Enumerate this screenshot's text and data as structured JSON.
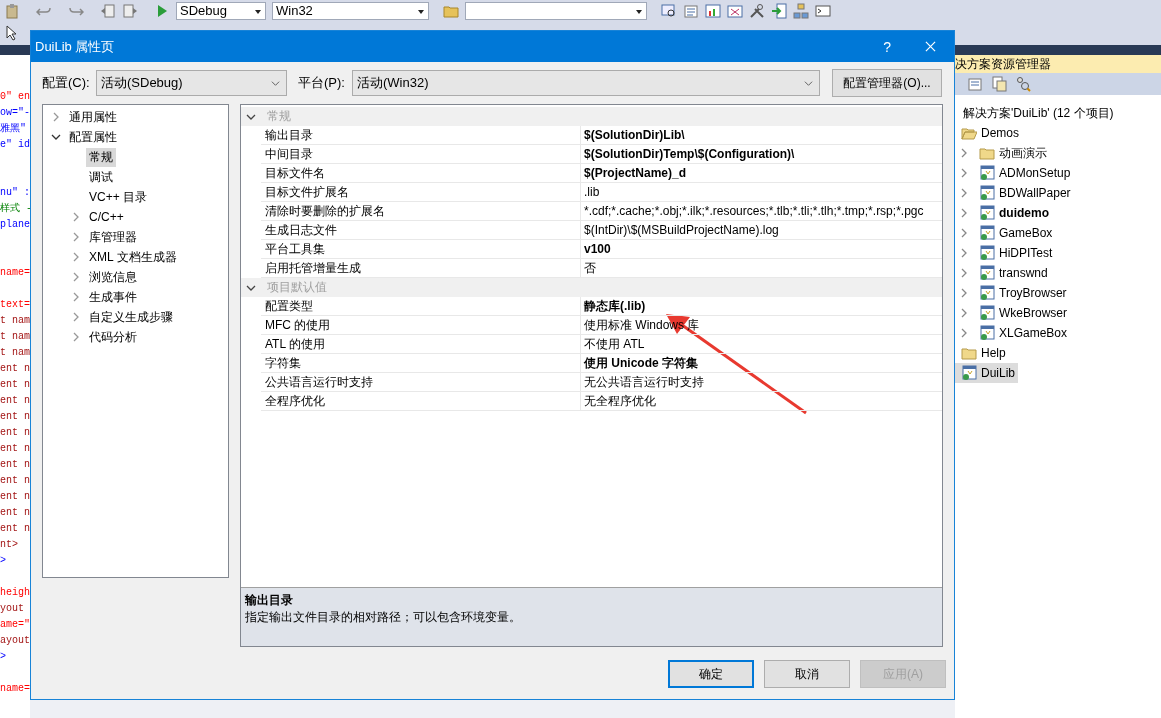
{
  "toolbar": {
    "configuration": "SDebug",
    "platform": "Win32"
  },
  "code_lines": [
    {
      "kind": "attribute",
      "text": "0\" en"
    },
    {
      "kind": "value",
      "text": "ow=\"-"
    },
    {
      "kind": "value",
      "text": "雅黑\""
    },
    {
      "kind": "value",
      "text": "e\" id"
    },
    {
      "kind": "blank"
    },
    {
      "kind": "blank"
    },
    {
      "kind": "value",
      "text": "nu\" :"
    },
    {
      "kind": "comment",
      "text": "样式 -"
    },
    {
      "kind": "value",
      "text": "plane"
    },
    {
      "kind": "blank"
    },
    {
      "kind": "blank"
    },
    {
      "kind": "attribute",
      "text": "name="
    },
    {
      "kind": "blank"
    },
    {
      "kind": "attribute",
      "text": "text="
    },
    {
      "kind": "tag",
      "text": "t nam"
    },
    {
      "kind": "tag",
      "text": "t nam"
    },
    {
      "kind": "tag",
      "text": "t nam"
    },
    {
      "kind": "tag",
      "text": "ent n"
    },
    {
      "kind": "tag",
      "text": "ent n"
    },
    {
      "kind": "tag",
      "text": "ent n"
    },
    {
      "kind": "tag",
      "text": "ent n"
    },
    {
      "kind": "tag",
      "text": "ent n"
    },
    {
      "kind": "tag",
      "text": "ent n"
    },
    {
      "kind": "tag",
      "text": "ent n"
    },
    {
      "kind": "tag",
      "text": "ent n"
    },
    {
      "kind": "tag",
      "text": "ent n"
    },
    {
      "kind": "tag",
      "text": "ent n"
    },
    {
      "kind": "tag",
      "text": "ent n"
    },
    {
      "kind": "tag",
      "text": "nt>"
    },
    {
      "kind": "value",
      "text": ">"
    },
    {
      "kind": "blank"
    },
    {
      "kind": "attribute",
      "text": "heigh"
    },
    {
      "kind": "tag",
      "text": "yout"
    },
    {
      "kind": "attribute",
      "text": "ame=\""
    },
    {
      "kind": "tag",
      "text": "ayout"
    },
    {
      "kind": "value",
      "text": ">"
    },
    {
      "kind": "blank"
    },
    {
      "kind": "attribute",
      "text": "name="
    }
  ],
  "solution_explorer": {
    "title": "决方案资源管理器",
    "root": "解决方案'DuiLib' (12 个项目)",
    "items": [
      {
        "label": "Demos",
        "kind": "folder",
        "expanded": true,
        "selected": false,
        "startup": false,
        "children": [
          {
            "label": "动画演示",
            "kind": "folder",
            "expanded": false,
            "selected": false,
            "startup": false
          },
          {
            "label": "ADMonSetup",
            "kind": "project",
            "expanded": false,
            "selected": false,
            "startup": false
          },
          {
            "label": "BDWallPaper",
            "kind": "project",
            "expanded": false,
            "selected": false,
            "startup": false
          },
          {
            "label": "duidemo",
            "kind": "project",
            "expanded": false,
            "selected": false,
            "startup": true
          },
          {
            "label": "GameBox",
            "kind": "project",
            "expanded": false,
            "selected": false,
            "startup": false
          },
          {
            "label": "HiDPITest",
            "kind": "project",
            "expanded": false,
            "selected": false,
            "startup": false
          },
          {
            "label": "transwnd",
            "kind": "project",
            "expanded": false,
            "selected": false,
            "startup": false
          },
          {
            "label": "TroyBrowser",
            "kind": "project",
            "expanded": false,
            "selected": false,
            "startup": false
          },
          {
            "label": "WkeBrowser",
            "kind": "project",
            "expanded": false,
            "selected": false,
            "startup": false
          },
          {
            "label": "XLGameBox",
            "kind": "project",
            "expanded": false,
            "selected": false,
            "startup": false
          }
        ]
      },
      {
        "label": "Help",
        "kind": "folder",
        "selected": false,
        "startup": false
      },
      {
        "label": "DuiLib",
        "kind": "project",
        "selected": true,
        "startup": false
      }
    ]
  },
  "dialog": {
    "title": "DuiLib 属性页",
    "help": "?",
    "configuration_label": "配置(C):",
    "configuration_value": "活动(SDebug)",
    "platform_label": "平台(P):",
    "platform_value": "活动(Win32)",
    "manager_button": "配置管理器(O)...",
    "tree": [
      {
        "label": "通用属性",
        "expanded": false
      },
      {
        "label": "配置属性",
        "expanded": true,
        "children": [
          {
            "label": "常规",
            "expandable": false,
            "selected": true
          },
          {
            "label": "调试",
            "expandable": false,
            "selected": false
          },
          {
            "label": "VC++ 目录",
            "expandable": false,
            "selected": false
          },
          {
            "label": "C/C++",
            "expandable": true,
            "selected": false
          },
          {
            "label": "库管理器",
            "expandable": true,
            "selected": false
          },
          {
            "label": "XML 文档生成器",
            "expandable": true,
            "selected": false
          },
          {
            "label": "浏览信息",
            "expandable": true,
            "selected": false
          },
          {
            "label": "生成事件",
            "expandable": true,
            "selected": false
          },
          {
            "label": "自定义生成步骤",
            "expandable": true,
            "selected": false
          },
          {
            "label": "代码分析",
            "expandable": true,
            "selected": false
          }
        ]
      }
    ],
    "grid": [
      {
        "category": "常规",
        "expanded": true,
        "rows": [
          {
            "name": "输出目录",
            "value": "$(SolutionDir)Lib\\",
            "bold": true
          },
          {
            "name": "中间目录",
            "value": "$(SolutionDir)Temp\\$(Configuration)\\",
            "bold": true
          },
          {
            "name": "目标文件名",
            "value": "$(ProjectName)_d",
            "bold": true
          },
          {
            "name": "目标文件扩展名",
            "value": ".lib",
            "bold": false
          },
          {
            "name": "清除时要删除的扩展名",
            "value": "*.cdf;*.cache;*.obj;*.ilk;*.resources;*.tlb;*.tli;*.tlh;*.tmp;*.rsp;*.pgc",
            "bold": false
          },
          {
            "name": "生成日志文件",
            "value": "$(IntDir)\\$(MSBuildProjectName).log",
            "bold": false
          },
          {
            "name": "平台工具集",
            "value": "v100",
            "bold": true
          },
          {
            "name": "启用托管增量生成",
            "value": "否",
            "bold": false
          }
        ]
      },
      {
        "category": "项目默认值",
        "expanded": true,
        "rows": [
          {
            "name": "配置类型",
            "value": "静态库(.lib)",
            "bold": true
          },
          {
            "name": "MFC 的使用",
            "value": "使用标准 Windows 库",
            "bold": false
          },
          {
            "name": "ATL 的使用",
            "value": "不使用 ATL",
            "bold": false
          },
          {
            "name": "字符集",
            "value": "使用 Unicode 字符集",
            "bold": true
          },
          {
            "name": "公共语言运行时支持",
            "value": "无公共语言运行时支持",
            "bold": false
          },
          {
            "name": "全程序优化",
            "value": "无全程序优化",
            "bold": false
          }
        ]
      }
    ],
    "description": {
      "title": "输出目录",
      "text": "指定输出文件目录的相对路径；可以包含环境变量。"
    },
    "buttons": [
      {
        "label": "确定",
        "default": true,
        "disabled": false
      },
      {
        "label": "取消",
        "default": false,
        "disabled": false
      },
      {
        "label": "应用(A)",
        "default": false,
        "disabled": true
      }
    ]
  }
}
